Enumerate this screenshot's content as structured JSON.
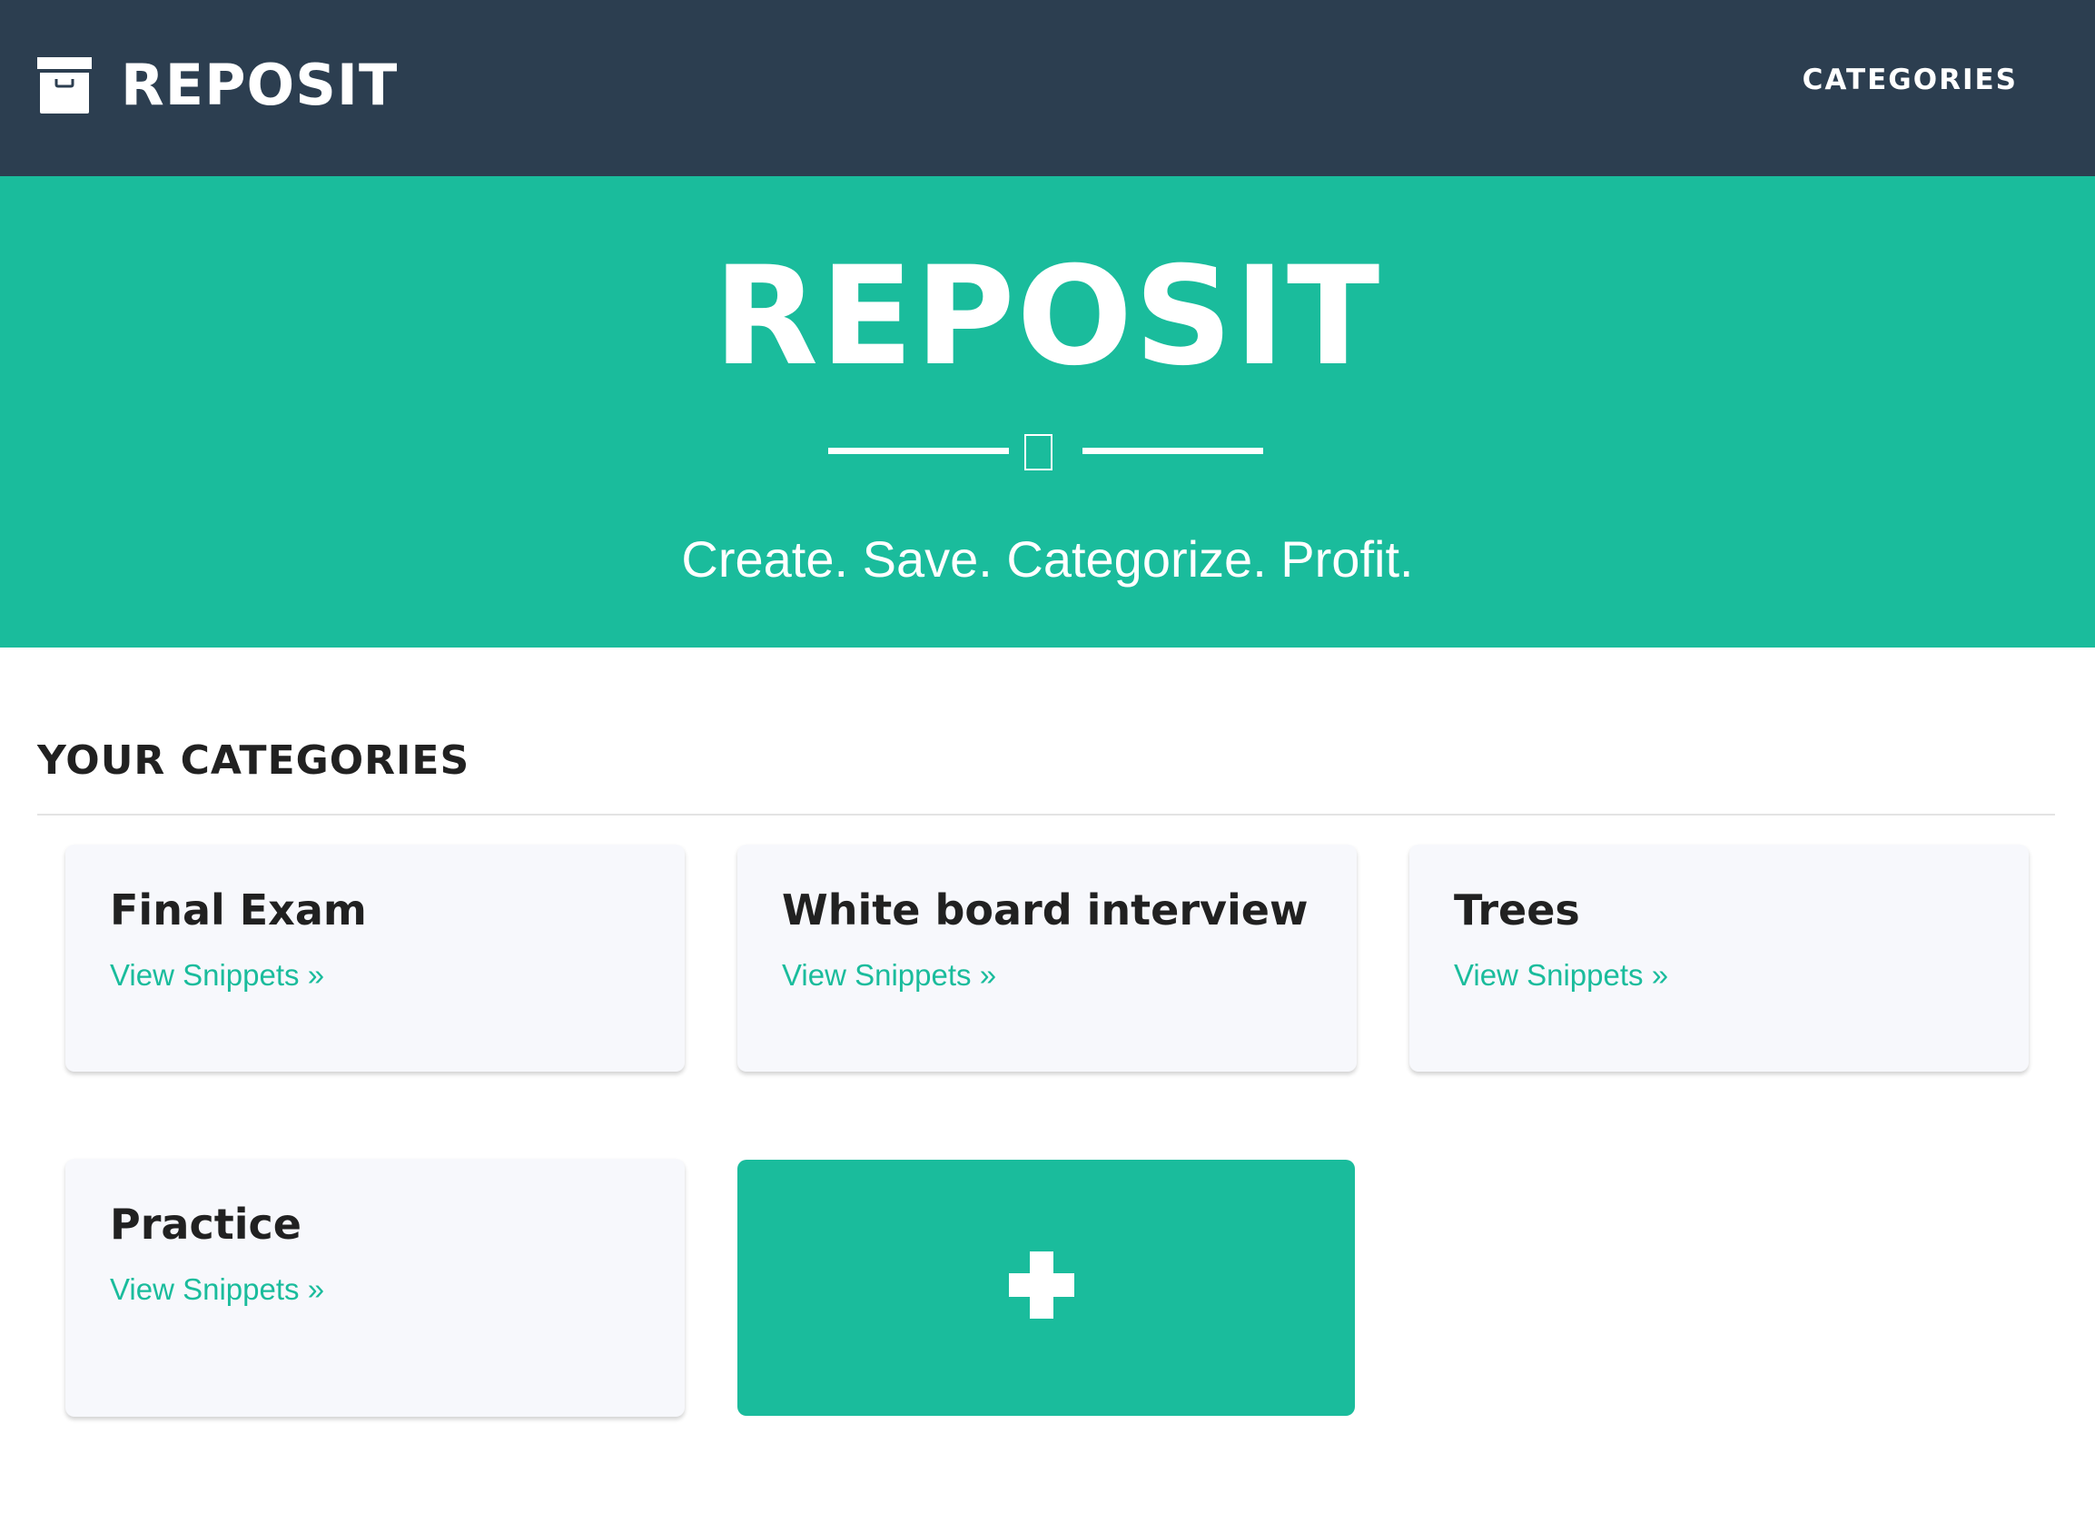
{
  "navbar": {
    "brand_icon": "archive-box-icon",
    "brand_text": "REPOSIT",
    "nav_link": "CATEGORIES",
    "background": "#2c3e50"
  },
  "hero": {
    "title": "REPOSIT",
    "divider_icon": "star-icon",
    "tagline": "Create. Save. Categorize. Profit.",
    "background": "#1abc9c"
  },
  "section": {
    "title": "YOUR CATEGORIES"
  },
  "categories": [
    {
      "title": "Final Exam",
      "link": "View Snippets »"
    },
    {
      "title": "White board interview",
      "link": "View Snippets »"
    },
    {
      "title": "Trees",
      "link": "View Snippets »"
    },
    {
      "title": "Practice",
      "link": "View Snippets »"
    }
  ],
  "add_card": {
    "icon": "plus-icon",
    "background": "#1abc9c"
  }
}
